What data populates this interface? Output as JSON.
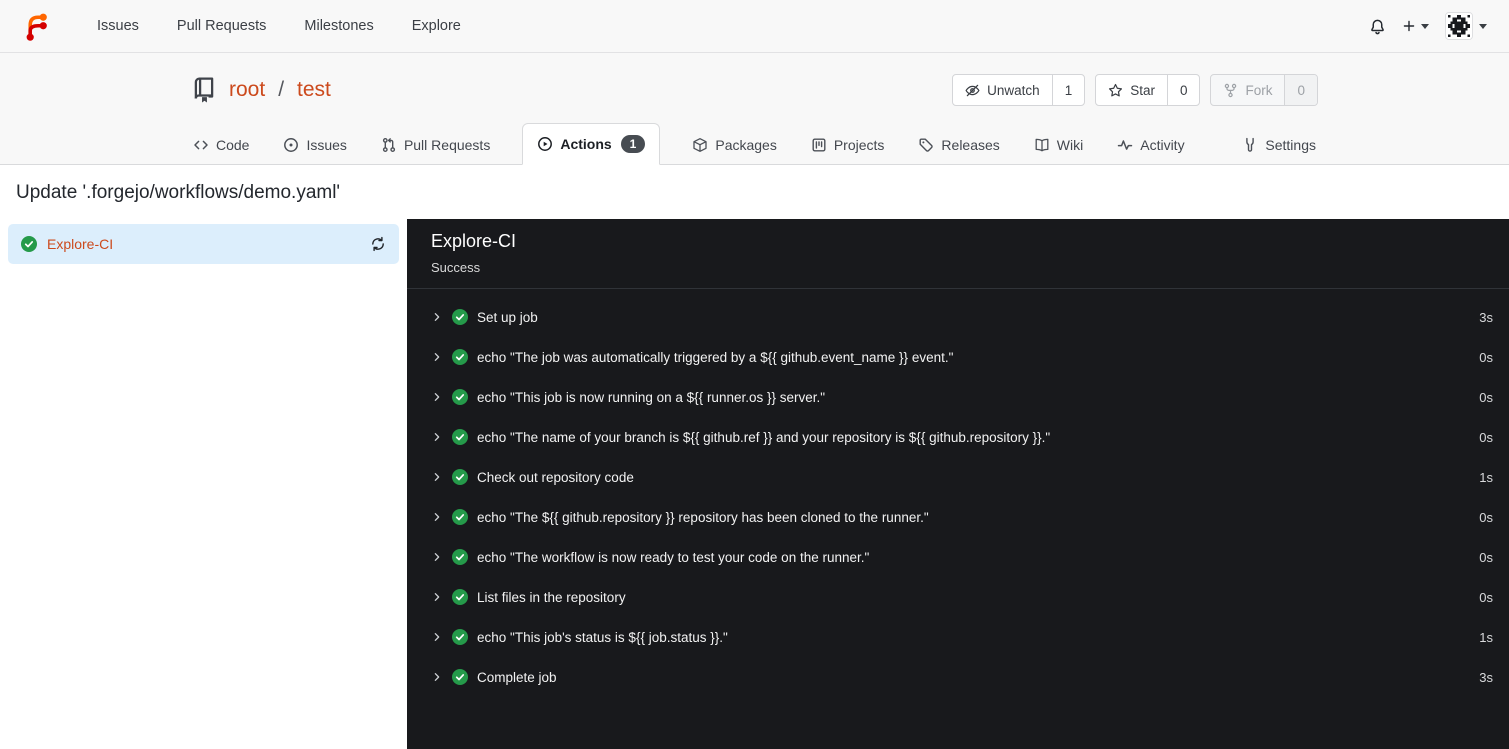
{
  "navbar": {
    "links": [
      {
        "label": "Issues"
      },
      {
        "label": "Pull Requests"
      },
      {
        "label": "Milestones"
      },
      {
        "label": "Explore"
      }
    ]
  },
  "repo": {
    "owner": "root",
    "separator": "/",
    "name": "test",
    "buttons": [
      {
        "label": "Unwatch",
        "count": "1",
        "icon": "eye-slash-icon",
        "disabled": false
      },
      {
        "label": "Star",
        "count": "0",
        "icon": "star-icon",
        "disabled": false
      },
      {
        "label": "Fork",
        "count": "0",
        "icon": "git-fork-icon",
        "disabled": true
      }
    ]
  },
  "tabs": [
    {
      "label": "Code",
      "icon": "code-icon",
      "active": false
    },
    {
      "label": "Issues",
      "icon": "issue-opened-icon",
      "active": false
    },
    {
      "label": "Pull Requests",
      "icon": "git-pull-request-icon",
      "active": false
    },
    {
      "label": "Actions",
      "icon": "play-circle-icon",
      "active": true,
      "badge": "1"
    },
    {
      "label": "Packages",
      "icon": "package-icon",
      "active": false
    },
    {
      "label": "Projects",
      "icon": "project-board-icon",
      "active": false
    },
    {
      "label": "Releases",
      "icon": "tag-icon",
      "active": false
    },
    {
      "label": "Wiki",
      "icon": "book-icon",
      "active": false
    },
    {
      "label": "Activity",
      "icon": "pulse-icon",
      "active": false
    },
    {
      "label": "Settings",
      "icon": "tools-icon",
      "active": false
    }
  ],
  "page": {
    "title": "Update '.forgejo/workflows/demo.yaml'"
  },
  "sidebar": {
    "jobs": [
      {
        "name": "Explore-CI",
        "status": "success"
      }
    ]
  },
  "panel": {
    "title": "Explore-CI",
    "status": "Success",
    "steps": [
      {
        "name": "Set up job",
        "duration": "3s"
      },
      {
        "name": "echo \"The job was automatically triggered by a ${{ github.event_name }} event.\"",
        "duration": "0s"
      },
      {
        "name": "echo \"This job is now running on a ${{ runner.os }} server.\"",
        "duration": "0s"
      },
      {
        "name": "echo \"The name of your branch is ${{ github.ref }} and your repository is ${{ github.repository }}.\"",
        "duration": "0s"
      },
      {
        "name": "Check out repository code",
        "duration": "1s"
      },
      {
        "name": "echo \"The ${{ github.repository }} repository has been cloned to the runner.\"",
        "duration": "0s"
      },
      {
        "name": "echo \"The workflow is now ready to test your code on the runner.\"",
        "duration": "0s"
      },
      {
        "name": "List files in the repository",
        "duration": "0s"
      },
      {
        "name": "echo \"This job's status is ${{ job.status }}.\"",
        "duration": "1s"
      },
      {
        "name": "Complete job",
        "duration": "3s"
      }
    ]
  },
  "colors": {
    "accent_link": "#cc4a1d",
    "success_green": "#259a4a",
    "selected_job_bg": "#dceefc",
    "panel_bg": "#18191c",
    "badge_bg": "#474c52",
    "header_bg": "#f8f8f8",
    "logo_orange": "#ff6600",
    "logo_red": "#d40000"
  }
}
